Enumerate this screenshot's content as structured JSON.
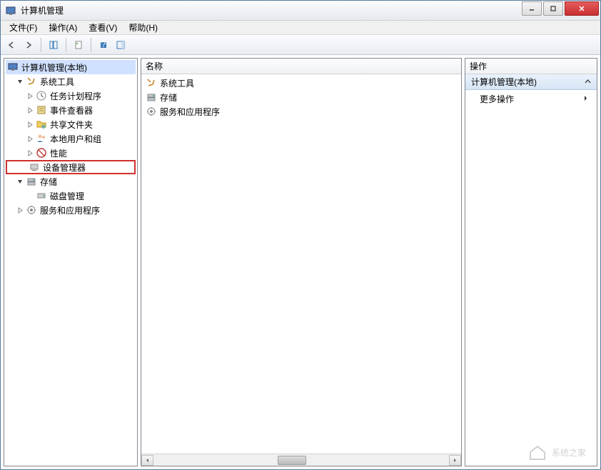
{
  "window": {
    "title": "计算机管理"
  },
  "menu": {
    "file": "文件(F)",
    "action": "操作(A)",
    "view": "查看(V)",
    "help": "帮助(H)"
  },
  "tree": {
    "root": "计算机管理(本地)",
    "systemTools": "系统工具",
    "taskScheduler": "任务计划程序",
    "eventViewer": "事件查看器",
    "sharedFolders": "共享文件夹",
    "localUsersGroups": "本地用户和组",
    "performance": "性能",
    "deviceManager": "设备管理器",
    "storage": "存储",
    "diskManagement": "磁盘管理",
    "servicesApps": "服务和应用程序"
  },
  "list": {
    "headerName": "名称",
    "items": [
      "系统工具",
      "存储",
      "服务和应用程序"
    ]
  },
  "actions": {
    "header": "操作",
    "sectionTitle": "计算机管理(本地)",
    "moreActions": "更多操作"
  },
  "watermark": "系统之家"
}
